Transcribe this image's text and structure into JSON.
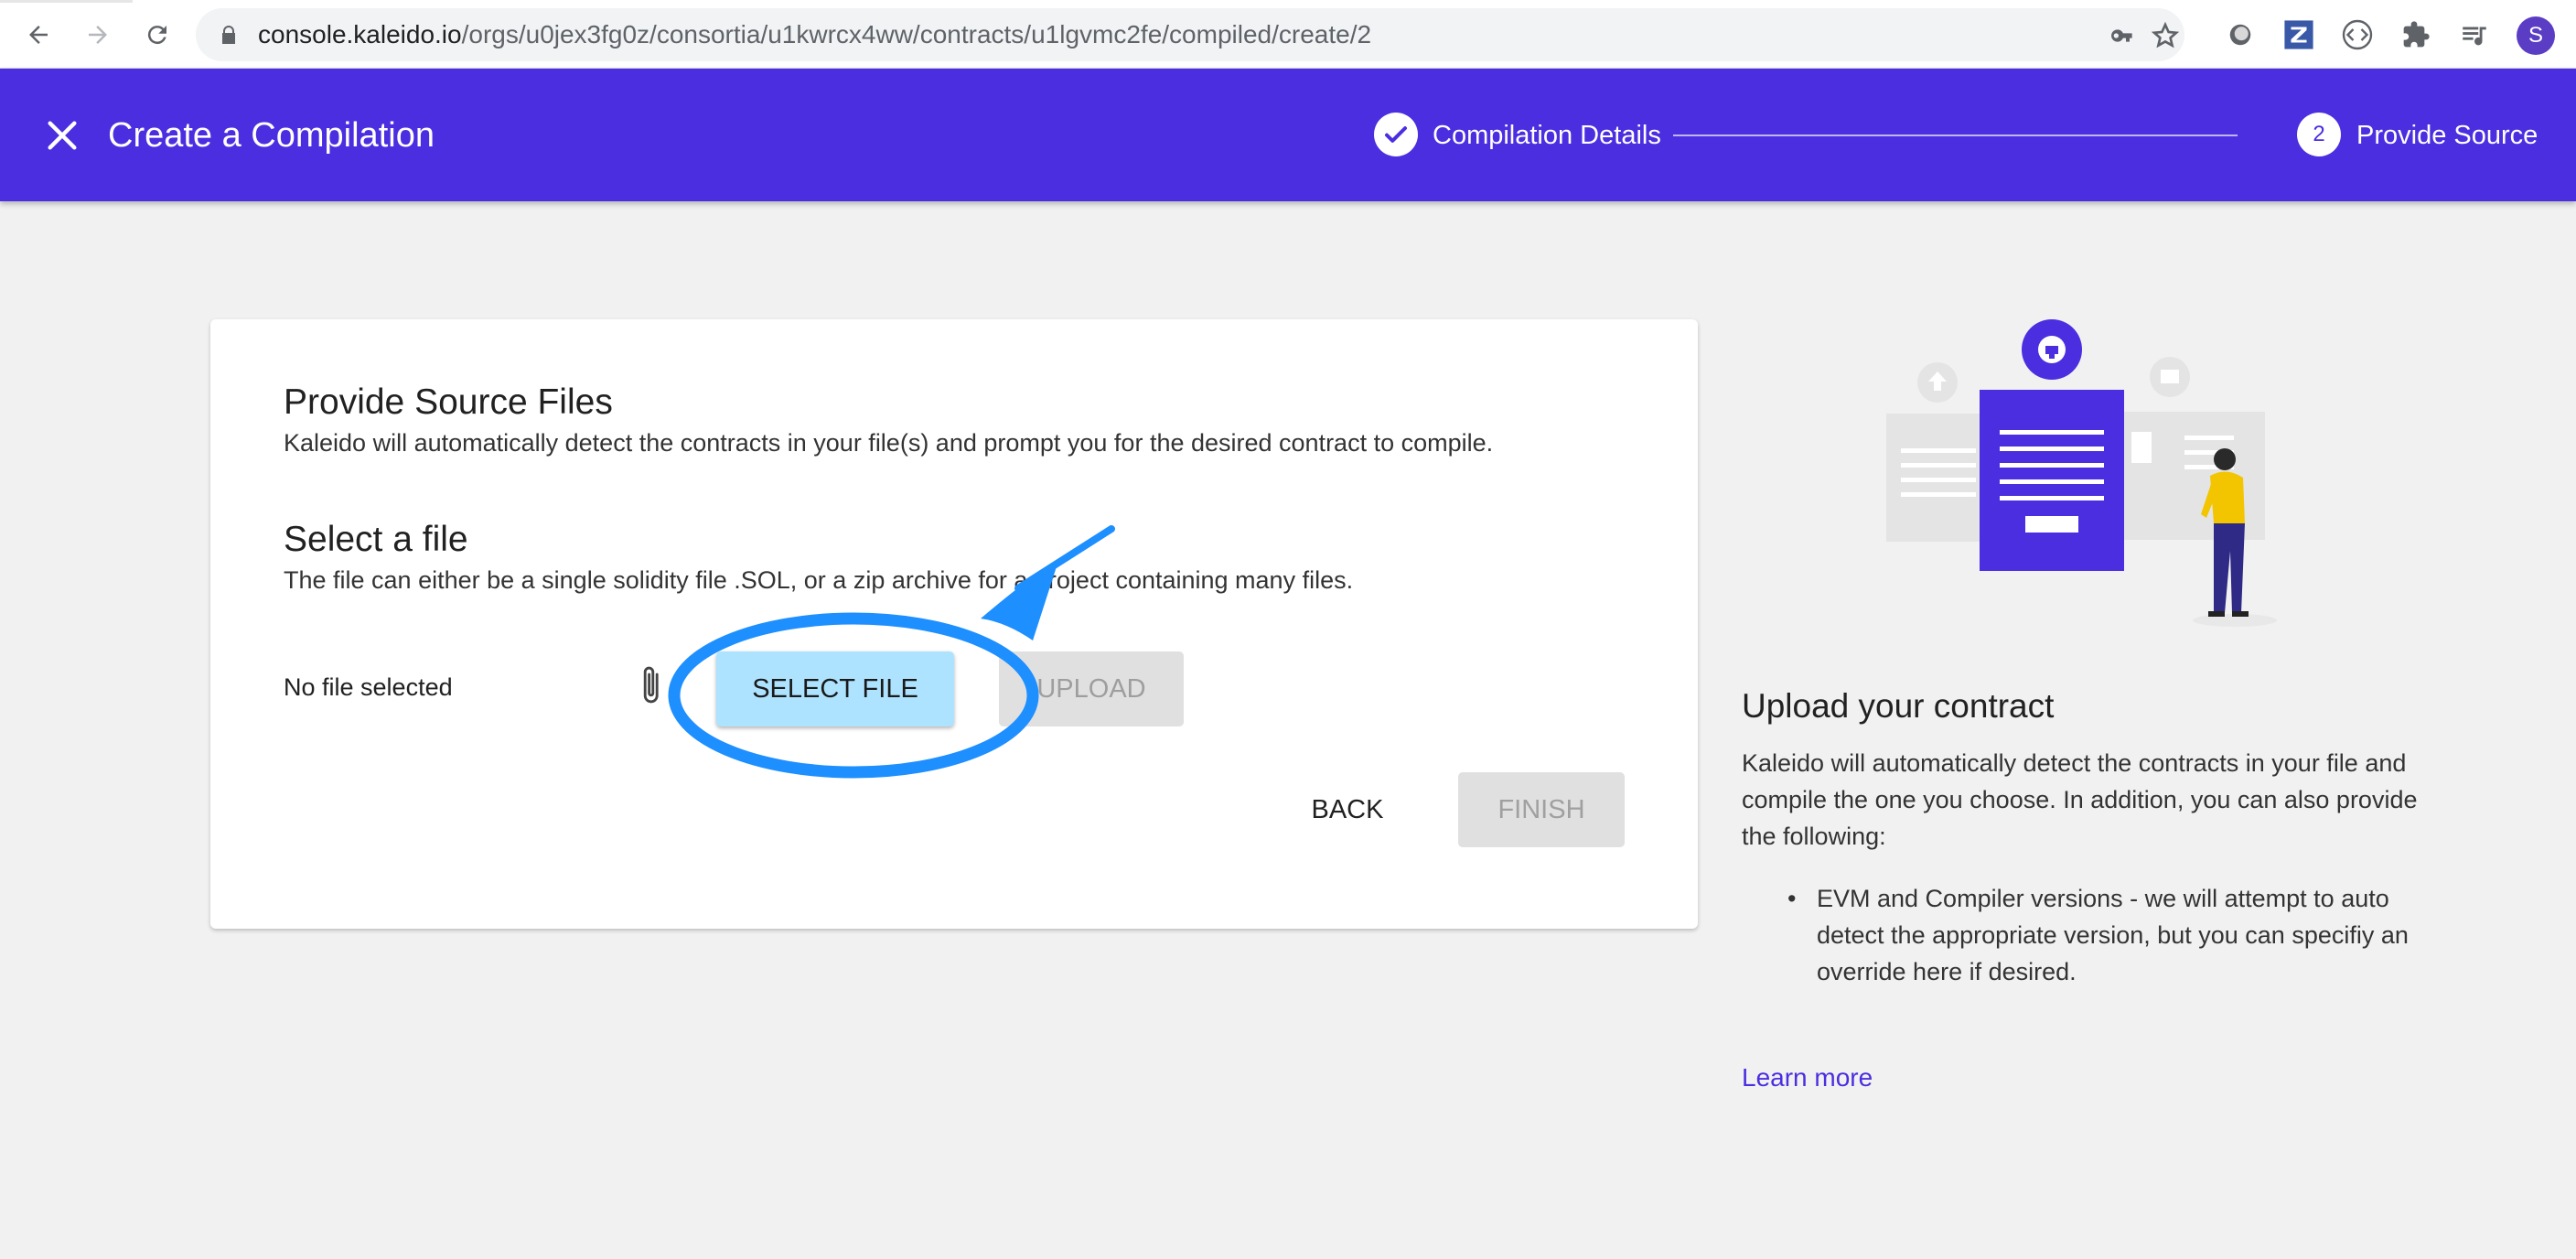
{
  "browser": {
    "url_host": "console.kaleido.io",
    "url_path": "/orgs/u0jex3fg0z/consortia/u1kwrcx4ww/contracts/u1lgvmc2fe/compiled/create/2",
    "avatar_letter": "S",
    "icons": [
      "back-icon",
      "forward-icon",
      "reload-icon",
      "lock-icon",
      "key-icon",
      "star-icon",
      "extension-icons",
      "puzzle-icon",
      "media-icon"
    ]
  },
  "header": {
    "title": "Create a Compilation",
    "steps": [
      {
        "label": "Compilation Details",
        "state": "complete"
      },
      {
        "label": "Provide Source",
        "number": "2",
        "state": "active"
      }
    ],
    "color": "#4b2ee0"
  },
  "card": {
    "title": "Provide Source Files",
    "subtitle": "Kaleido will automatically detect the contracts in your file(s) and prompt you for the desired contract to compile.",
    "select_title": "Select a file",
    "select_desc": "The file can either be a single solidity file .SOL, or a zip archive for a project containing many files.",
    "file_status": "No file selected",
    "select_button": "SELECT FILE",
    "upload_button": "UPLOAD",
    "back_button": "BACK",
    "finish_button": "FINISH"
  },
  "side": {
    "title": "Upload your contract",
    "text": "Kaleido will automatically detect the contracts in your file and compile the one you choose. In addition, you can also provide the following:",
    "bullets": [
      "EVM and Compiler versions - we will attempt to auto detect the appropriate version, but you can specifiy an override here if desired."
    ],
    "link": "Learn more"
  },
  "colors": {
    "accent": "#4b2ee0",
    "select_button_bg": "#aee3ff",
    "annotation_blue": "#1e8fff"
  }
}
